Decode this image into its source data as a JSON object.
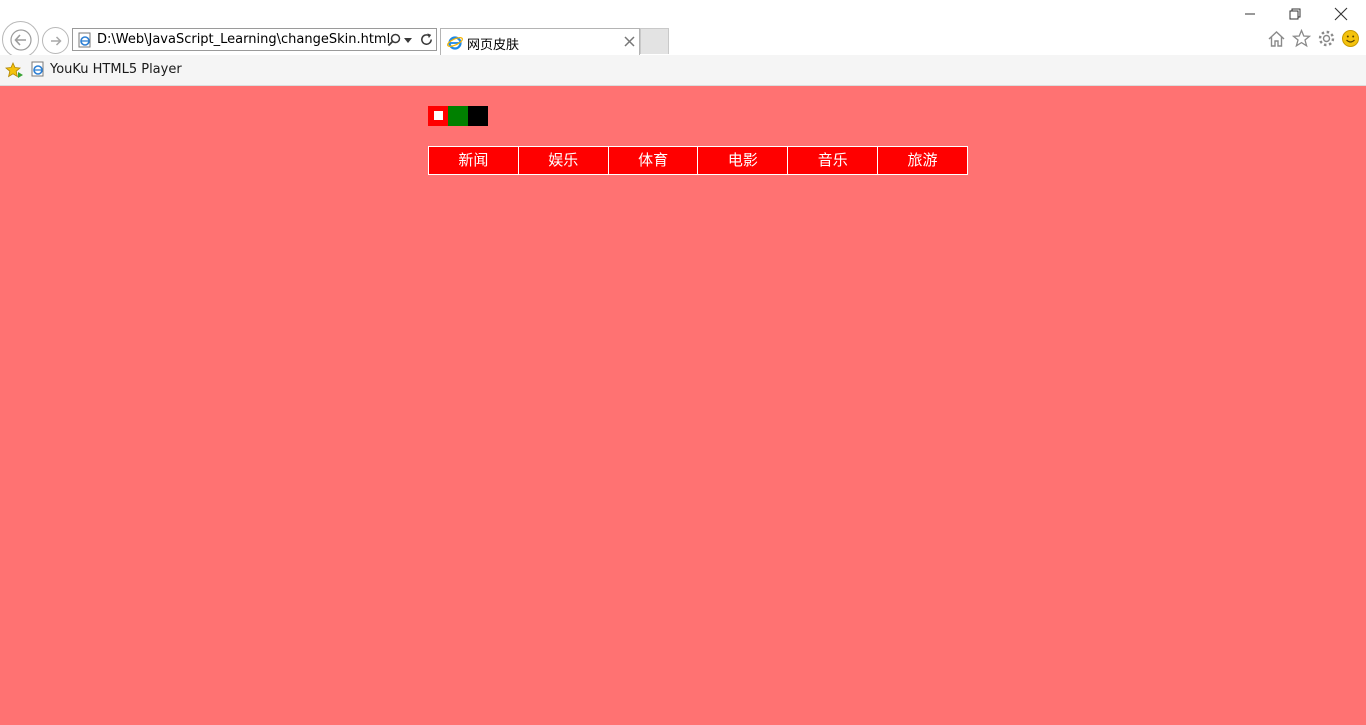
{
  "browser": {
    "address": {
      "url": "D:\\Web\\JavaScript_Learning\\changeSkin.html"
    },
    "tab": {
      "title": "网页皮肤"
    },
    "favorites_bar": {
      "link_label": "YouKu HTML5 Player"
    },
    "icons": {
      "back": "back-arrow-icon",
      "forward": "forward-arrow-icon",
      "search": "search-icon",
      "refresh": "refresh-icon",
      "home": "home-icon",
      "favorites": "star-icon",
      "settings": "gear-icon",
      "feedback": "smiley-icon"
    }
  },
  "page": {
    "background": "#ff7272",
    "skins": [
      {
        "name": "red",
        "color": "#ff0000",
        "selected": true
      },
      {
        "name": "green",
        "color": "#008000",
        "selected": false
      },
      {
        "name": "black",
        "color": "#000000",
        "selected": false
      }
    ],
    "menu_background": "#ff0000",
    "menu": [
      {
        "label": "新闻"
      },
      {
        "label": "娱乐"
      },
      {
        "label": "体育"
      },
      {
        "label": "电影"
      },
      {
        "label": "音乐"
      },
      {
        "label": "旅游"
      }
    ]
  }
}
